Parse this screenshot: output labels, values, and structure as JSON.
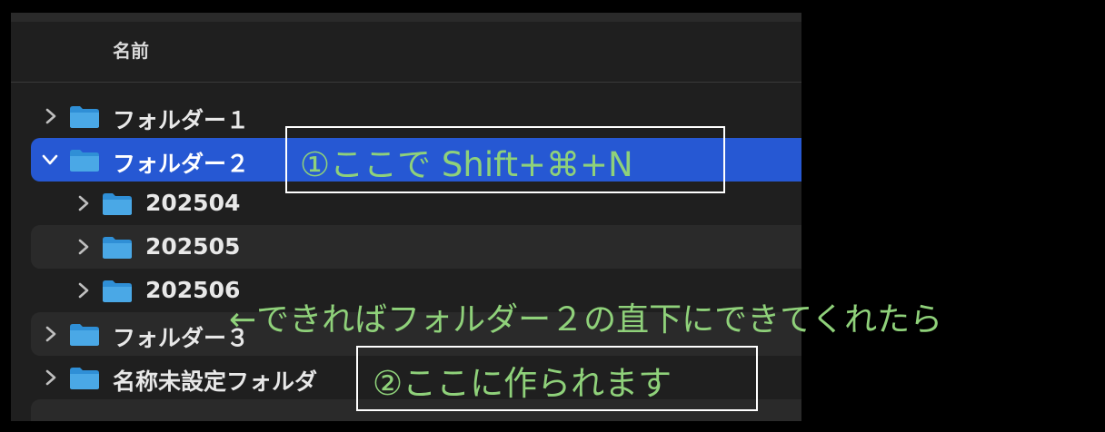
{
  "header": {
    "name_column": "名前"
  },
  "rows": [
    {
      "label": "フォルダー１",
      "expanded": false,
      "level": 0,
      "selected": false,
      "alt": false
    },
    {
      "label": "フォルダー２",
      "expanded": true,
      "level": 0,
      "selected": true,
      "alt": false
    },
    {
      "label": "202504",
      "expanded": false,
      "level": 1,
      "selected": false,
      "alt": false
    },
    {
      "label": "202505",
      "expanded": false,
      "level": 1,
      "selected": false,
      "alt": true
    },
    {
      "label": "202506",
      "expanded": false,
      "level": 1,
      "selected": false,
      "alt": false
    },
    {
      "label": "フォルダー３",
      "expanded": false,
      "level": 0,
      "selected": false,
      "alt": true
    },
    {
      "label": "名称未設定フォルダ",
      "expanded": false,
      "level": 0,
      "selected": false,
      "alt": false
    }
  ],
  "annotations": {
    "step1": "①ここで Shift+⌘+N",
    "note": "←できればフォルダー２の直下にできてくれたら",
    "step2": "②ここに作られます"
  },
  "colors": {
    "selection": "#2658d3",
    "annotation_text": "#8fd17a",
    "folder_blue": "#4aa8e6"
  },
  "icons": {
    "folder": "folder-icon",
    "collapsed": "chevron-right-icon",
    "expanded": "chevron-down-icon"
  }
}
